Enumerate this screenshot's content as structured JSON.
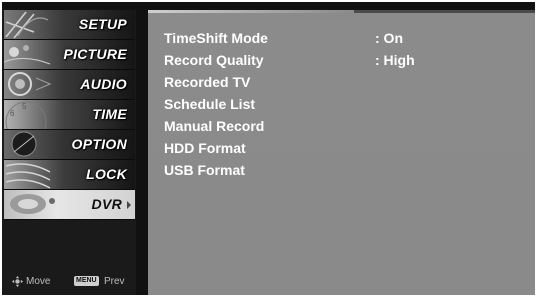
{
  "sidebar": {
    "items": [
      {
        "label": "SETUP",
        "selected": false,
        "icon": "satellite-dish-icon"
      },
      {
        "label": "PICTURE",
        "selected": false,
        "icon": "picture-thumbnail-icon"
      },
      {
        "label": "AUDIO",
        "selected": false,
        "icon": "speaker-icon"
      },
      {
        "label": "TIME",
        "selected": false,
        "icon": "clock-icon"
      },
      {
        "label": "OPTION",
        "selected": false,
        "icon": "option-tag-icon"
      },
      {
        "label": "LOCK",
        "selected": false,
        "icon": "lock-icon"
      },
      {
        "label": "DVR",
        "selected": true,
        "icon": "disc-icon"
      }
    ],
    "footer": {
      "move_label": "Move",
      "menu_key_label": "MENU",
      "prev_label": "Prev"
    }
  },
  "main": {
    "settings": [
      {
        "label": "TimeShift Mode",
        "value": ": On"
      },
      {
        "label": "Record Quality",
        "value": ": High"
      },
      {
        "label": "Recorded TV",
        "value": ""
      },
      {
        "label": "Schedule List",
        "value": ""
      },
      {
        "label": "Manual Record",
        "value": ""
      },
      {
        "label": "HDD Format",
        "value": ""
      },
      {
        "label": "USB Format",
        "value": ""
      }
    ]
  },
  "colors": {
    "panel_gray": "#8a8a8a",
    "background_black": "#111111",
    "text_white": "#ffffff",
    "selected_bg": "#e0e0e0"
  }
}
